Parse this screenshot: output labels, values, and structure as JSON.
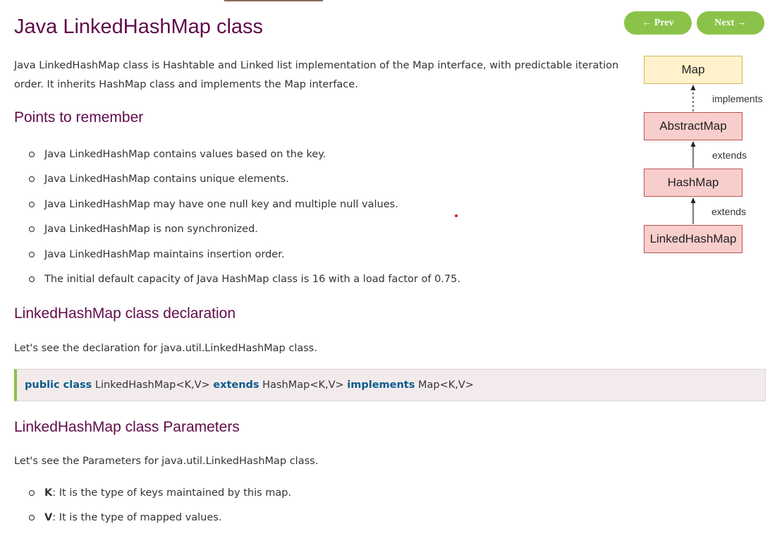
{
  "page": {
    "title": "Java LinkedHashMap class",
    "nav": {
      "prev": "← Prev",
      "next": "Next →"
    },
    "intro": "Java LinkedHashMap class is Hashtable and Linked list implementation of the Map interface, with predictable iteration order. It inherits HashMap class and implements the Map interface."
  },
  "points": {
    "heading": "Points to remember",
    "items": [
      "Java LinkedHashMap contains values based on the key.",
      "Java LinkedHashMap contains unique elements.",
      "Java LinkedHashMap may have one null key and multiple null values.",
      "Java LinkedHashMap is non synchronized.",
      "Java LinkedHashMap maintains insertion order.",
      "The initial default capacity of Java HashMap class is 16 with a load factor of 0.75."
    ]
  },
  "declaration": {
    "heading": "LinkedHashMap class declaration",
    "text": "Let's see the declaration for java.util.LinkedHashMap class.",
    "code": {
      "kw1": "public class",
      "t1": " LinkedHashMap<K,V> ",
      "kw2": "extends",
      "t2": " HashMap<K,V> ",
      "kw3": "implements",
      "t3": " Map<K,V>"
    }
  },
  "parameters": {
    "heading": "LinkedHashMap class Parameters",
    "text": "Let's see the Parameters for java.util.LinkedHashMap class.",
    "items": [
      {
        "term": "K",
        "desc": ": It is the type of keys maintained by this map."
      },
      {
        "term": "V",
        "desc": ": It is the type of mapped values."
      }
    ]
  },
  "diagram": {
    "nodes": [
      "Map",
      "AbstractMap",
      "HashMap",
      "LinkedHashMap"
    ],
    "relations": [
      "implements",
      "extends",
      "extends"
    ],
    "colors": {
      "interface_fill": "#fff2cc",
      "class_fill": "#f8cecc"
    }
  },
  "colors": {
    "heading": "#610b4b",
    "button": "#8bc34a",
    "keyword": "#0b5c8e"
  }
}
